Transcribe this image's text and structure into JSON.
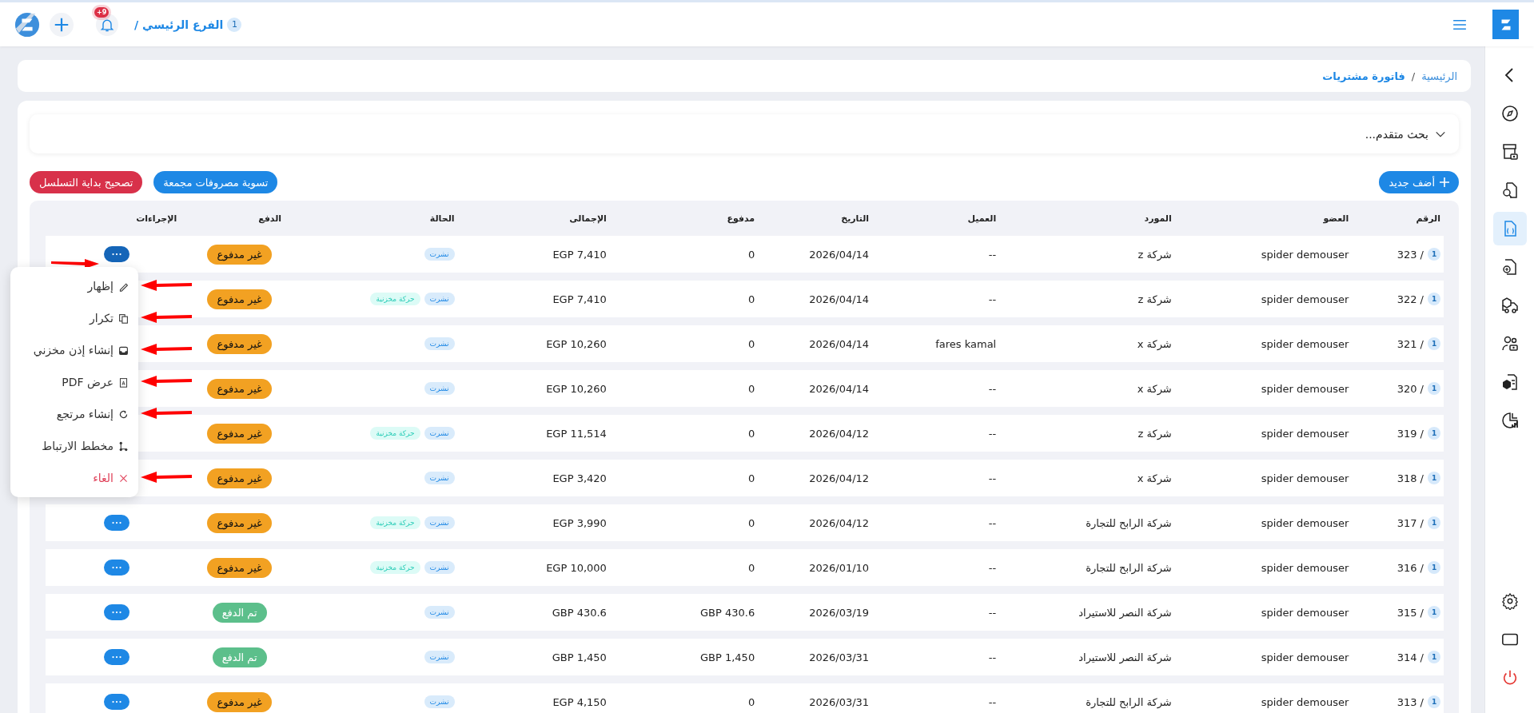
{
  "topbar": {
    "branch": {
      "badge": "1",
      "label": "الفرع الرئيسي /"
    },
    "notifications": {
      "badge": "+9"
    }
  },
  "sidebar": {
    "items": [
      {
        "kind": "collapse",
        "selected": false
      },
      {
        "kind": "compass",
        "selected": false
      },
      {
        "kind": "register",
        "selected": false
      },
      {
        "kind": "file-search",
        "selected": false
      },
      {
        "kind": "file-code",
        "selected": true
      },
      {
        "kind": "file-refresh",
        "selected": false
      },
      {
        "kind": "truck-box",
        "selected": false
      },
      {
        "kind": "users",
        "selected": false
      },
      {
        "kind": "box-file",
        "selected": false
      },
      {
        "kind": "pie-chart",
        "selected": false
      }
    ],
    "bottom_items": [
      {
        "kind": "settings"
      },
      {
        "kind": "monitor"
      },
      {
        "kind": "power"
      }
    ]
  },
  "breadcrumb": {
    "home": "الرئيسية",
    "separator": "/",
    "current": "فاتورة مشتريات"
  },
  "search": {
    "label": "بحث متقدم..."
  },
  "buttons": [
    {
      "label": "أضف جديد",
      "kind": "add"
    },
    {
      "label": "تسوية مصروفات مجمعة",
      "kind": "primary"
    },
    {
      "label": "تصحيح بداية التسلسل",
      "kind": "danger"
    }
  ],
  "table": {
    "columns": [
      "الرقم",
      "العضو",
      "المورد",
      "العميل",
      "التاريخ",
      "مدفوع",
      "الإجمالى",
      "الحالة",
      "الدفع",
      "الإجراءات"
    ],
    "rows": [
      {
        "branch": "1",
        "number": "323 /",
        "member": "spider demouser",
        "supplier": "شركة z",
        "customer": "--",
        "date": "2026/04/14",
        "paid": "0",
        "total": "EGP 7,410",
        "tags": [
          {
            "label": "نشرت",
            "kind": "published"
          }
        ],
        "payment": {
          "label": "غير مدفوع",
          "kind": "unpaid"
        },
        "more_button": {
          "selected": true,
          "marked": true
        }
      },
      {
        "branch": "1",
        "number": "322 /",
        "member": "spider demouser",
        "supplier": "شركة z",
        "customer": "--",
        "date": "2026/04/14",
        "paid": "0",
        "total": "EGP 7,410",
        "tags": [
          {
            "label": "نشرت",
            "kind": "published"
          },
          {
            "label": "حركة مخزنية",
            "kind": "stock"
          }
        ],
        "payment": {
          "label": "غير مدفوع",
          "kind": "unpaid"
        }
      },
      {
        "branch": "1",
        "number": "321 /",
        "member": "spider demouser",
        "supplier": "شركة x",
        "customer": "fares kamal",
        "date": "2026/04/14",
        "paid": "0",
        "total": "EGP 10,260",
        "tags": [
          {
            "label": "نشرت",
            "kind": "published"
          }
        ],
        "payment": {
          "label": "غير مدفوع",
          "kind": "unpaid"
        }
      },
      {
        "branch": "1",
        "number": "320 /",
        "member": "spider demouser",
        "supplier": "شركة x",
        "customer": "--",
        "date": "2026/04/14",
        "paid": "0",
        "total": "EGP 10,260",
        "tags": [
          {
            "label": "نشرت",
            "kind": "published"
          }
        ],
        "payment": {
          "label": "غير مدفوع",
          "kind": "unpaid"
        }
      },
      {
        "branch": "1",
        "number": "319 /",
        "member": "spider demouser",
        "supplier": "شركة z",
        "customer": "--",
        "date": "2026/04/12",
        "paid": "0",
        "total": "EGP 11,514",
        "tags": [
          {
            "label": "نشرت",
            "kind": "published"
          },
          {
            "label": "حركة مخزنية",
            "kind": "stock"
          }
        ],
        "payment": {
          "label": "غير مدفوع",
          "kind": "unpaid"
        }
      },
      {
        "branch": "1",
        "number": "318 /",
        "member": "spider demouser",
        "supplier": "شركة x",
        "customer": "--",
        "date": "2026/04/12",
        "paid": "0",
        "total": "EGP 3,420",
        "tags": [
          {
            "label": "نشرت",
            "kind": "published"
          }
        ],
        "payment": {
          "label": "غير مدفوع",
          "kind": "unpaid"
        }
      },
      {
        "branch": "1",
        "number": "317 /",
        "member": "spider demouser",
        "supplier": "شركة الرابح للتجارة",
        "customer": "--",
        "date": "2026/04/12",
        "paid": "0",
        "total": "EGP 3,990",
        "tags": [
          {
            "label": "نشرت",
            "kind": "published"
          },
          {
            "label": "حركة مخزنية",
            "kind": "stock"
          }
        ],
        "payment": {
          "label": "غير مدفوع",
          "kind": "unpaid"
        },
        "more_button": {
          "selected": false
        }
      },
      {
        "branch": "1",
        "number": "316 /",
        "member": "spider demouser",
        "supplier": "شركة الرابح للتجارة",
        "customer": "--",
        "date": "2026/01/10",
        "paid": "0",
        "total": "EGP 10,000",
        "tags": [
          {
            "label": "نشرت",
            "kind": "published"
          },
          {
            "label": "حركة مخزنية",
            "kind": "stock"
          }
        ],
        "payment": {
          "label": "غير مدفوع",
          "kind": "unpaid"
        },
        "more_button": {
          "selected": false
        }
      },
      {
        "branch": "1",
        "number": "315 /",
        "member": "spider demouser",
        "supplier": "شركة النصر للاستيراد",
        "customer": "--",
        "date": "2026/03/19",
        "paid": "GBP 430.6",
        "total": "GBP 430.6",
        "tags": [
          {
            "label": "نشرت",
            "kind": "published"
          }
        ],
        "payment": {
          "label": "تم الدفع",
          "kind": "paid"
        },
        "more_button": {
          "selected": false
        }
      },
      {
        "branch": "1",
        "number": "314 /",
        "member": "spider demouser",
        "supplier": "شركة النصر للاستيراد",
        "customer": "--",
        "date": "2026/03/31",
        "paid": "GBP 1,450",
        "total": "GBP 1,450",
        "tags": [
          {
            "label": "نشرت",
            "kind": "published"
          }
        ],
        "payment": {
          "label": "تم الدفع",
          "kind": "paid"
        },
        "more_button": {
          "selected": false
        }
      },
      {
        "branch": "1",
        "number": "313 /",
        "member": "spider demouser",
        "supplier": "شركة الرابح للتجارة",
        "customer": "--",
        "date": "2026/03/31",
        "paid": "0",
        "total": "EGP 4,150",
        "tags": [
          {
            "label": "نشرت",
            "kind": "published"
          }
        ],
        "payment": {
          "label": "غير مدفوع",
          "kind": "unpaid"
        },
        "more_button": {
          "selected": false
        }
      }
    ]
  },
  "action_menu": {
    "items": [
      {
        "label": "إظهار",
        "kind": "edit",
        "marked": true
      },
      {
        "label": "تكرار",
        "kind": "copy",
        "marked": true
      },
      {
        "label": "إنشاء إذن مخزني",
        "kind": "inbox",
        "marked": true
      },
      {
        "label": "عرض PDF",
        "kind": "pdf",
        "marked": true
      },
      {
        "label": "إنشاء مرتجع",
        "kind": "refresh",
        "marked": true
      },
      {
        "label": "مخطط الارتباط",
        "kind": "diagram",
        "marked": false
      },
      {
        "label": "الغاء",
        "kind": "cancel",
        "marked": true
      }
    ]
  }
}
